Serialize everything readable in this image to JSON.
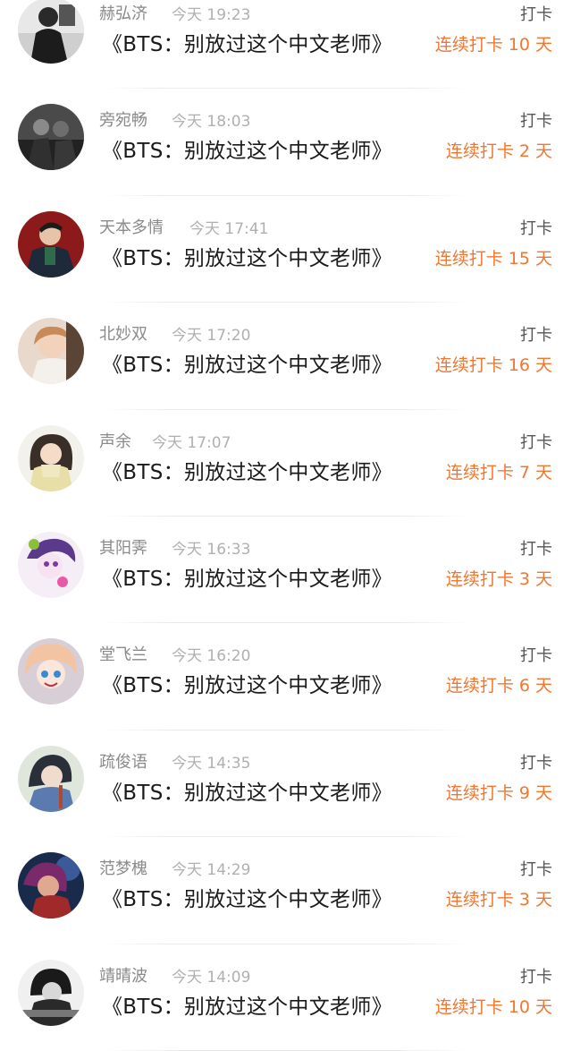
{
  "colors": {
    "accent": "#f2762e",
    "name": "#8a8a8a",
    "time": "#b0b0b0",
    "title": "#1a1a1a"
  },
  "checkins": [
    {
      "user": "赫弘济",
      "time": "今天 19:23",
      "title": "《BTS：别放过这个中文老师》",
      "action": "打卡",
      "streak": "连续打卡 10 天"
    },
    {
      "user": "旁宛畅",
      "time": "今天 18:03",
      "title": "《BTS：别放过这个中文老师》",
      "action": "打卡",
      "streak": "连续打卡 2 天"
    },
    {
      "user": "天本多情",
      "time": "今天 17:41",
      "title": "《BTS：别放过这个中文老师》",
      "action": "打卡",
      "streak": "连续打卡 15 天"
    },
    {
      "user": "北妙双",
      "time": "今天 17:20",
      "title": "《BTS：别放过这个中文老师》",
      "action": "打卡",
      "streak": "连续打卡 16 天"
    },
    {
      "user": "声余",
      "time": "今天 17:07",
      "title": "《BTS：别放过这个中文老师》",
      "action": "打卡",
      "streak": "连续打卡 7 天"
    },
    {
      "user": "其阳霁",
      "time": "今天 16:33",
      "title": "《BTS：别放过这个中文老师》",
      "action": "打卡",
      "streak": "连续打卡 3 天"
    },
    {
      "user": "堂飞兰",
      "time": "今天 16:20",
      "title": "《BTS：别放过这个中文老师》",
      "action": "打卡",
      "streak": "连续打卡 6 天"
    },
    {
      "user": "疏俊语",
      "time": "今天 14:35",
      "title": "《BTS：别放过这个中文老师》",
      "action": "打卡",
      "streak": "连续打卡 9 天"
    },
    {
      "user": "范梦槐",
      "time": "今天 14:29",
      "title": "《BTS：别放过这个中文老师》",
      "action": "打卡",
      "streak": "连续打卡 3 天"
    },
    {
      "user": "靖晴波",
      "time": "今天 14:09",
      "title": "《BTS：别放过这个中文老师》",
      "action": "打卡",
      "streak": "连续打卡 10 天"
    }
  ]
}
